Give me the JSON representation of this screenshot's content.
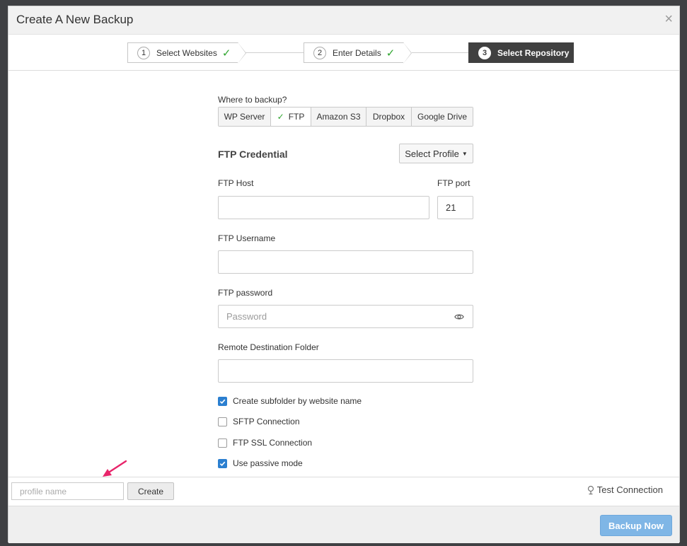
{
  "modal": {
    "title": "Create A New Backup",
    "close": "×"
  },
  "steps": [
    {
      "num": "1",
      "label": "Select Websites",
      "done": true
    },
    {
      "num": "2",
      "label": "Enter Details",
      "done": true
    },
    {
      "num": "3",
      "label": "Select Repository",
      "active": true
    }
  ],
  "form": {
    "where_label": "Where to backup?",
    "destinations": [
      "WP Server",
      "FTP",
      "Amazon S3",
      "Dropbox",
      "Google Drive"
    ],
    "selected_destination": "FTP",
    "credential_heading": "FTP Credential",
    "select_profile": "Select Profile",
    "host_label": "FTP Host",
    "host_value": "",
    "port_label": "FTP port",
    "port_value": "21",
    "username_label": "FTP Username",
    "username_value": "",
    "password_label": "FTP password",
    "password_placeholder": "Password",
    "folder_label": "Remote Destination Folder",
    "folder_value": "",
    "options": [
      {
        "label": "Create subfolder by website name",
        "checked": true
      },
      {
        "label": "SFTP Connection",
        "checked": false
      },
      {
        "label": "FTP SSL Connection",
        "checked": false
      },
      {
        "label": "Use passive mode",
        "checked": true
      }
    ]
  },
  "profile_bar": {
    "name_placeholder": "profile name",
    "create_label": "Create",
    "test_connection_label": "Test Connection"
  },
  "footer": {
    "backup_now_label": "Backup Now"
  },
  "colors": {
    "accent": "#2b7fd0",
    "check": "#2ea52e",
    "active_step": "#404040",
    "annotation": "#e8246a"
  }
}
